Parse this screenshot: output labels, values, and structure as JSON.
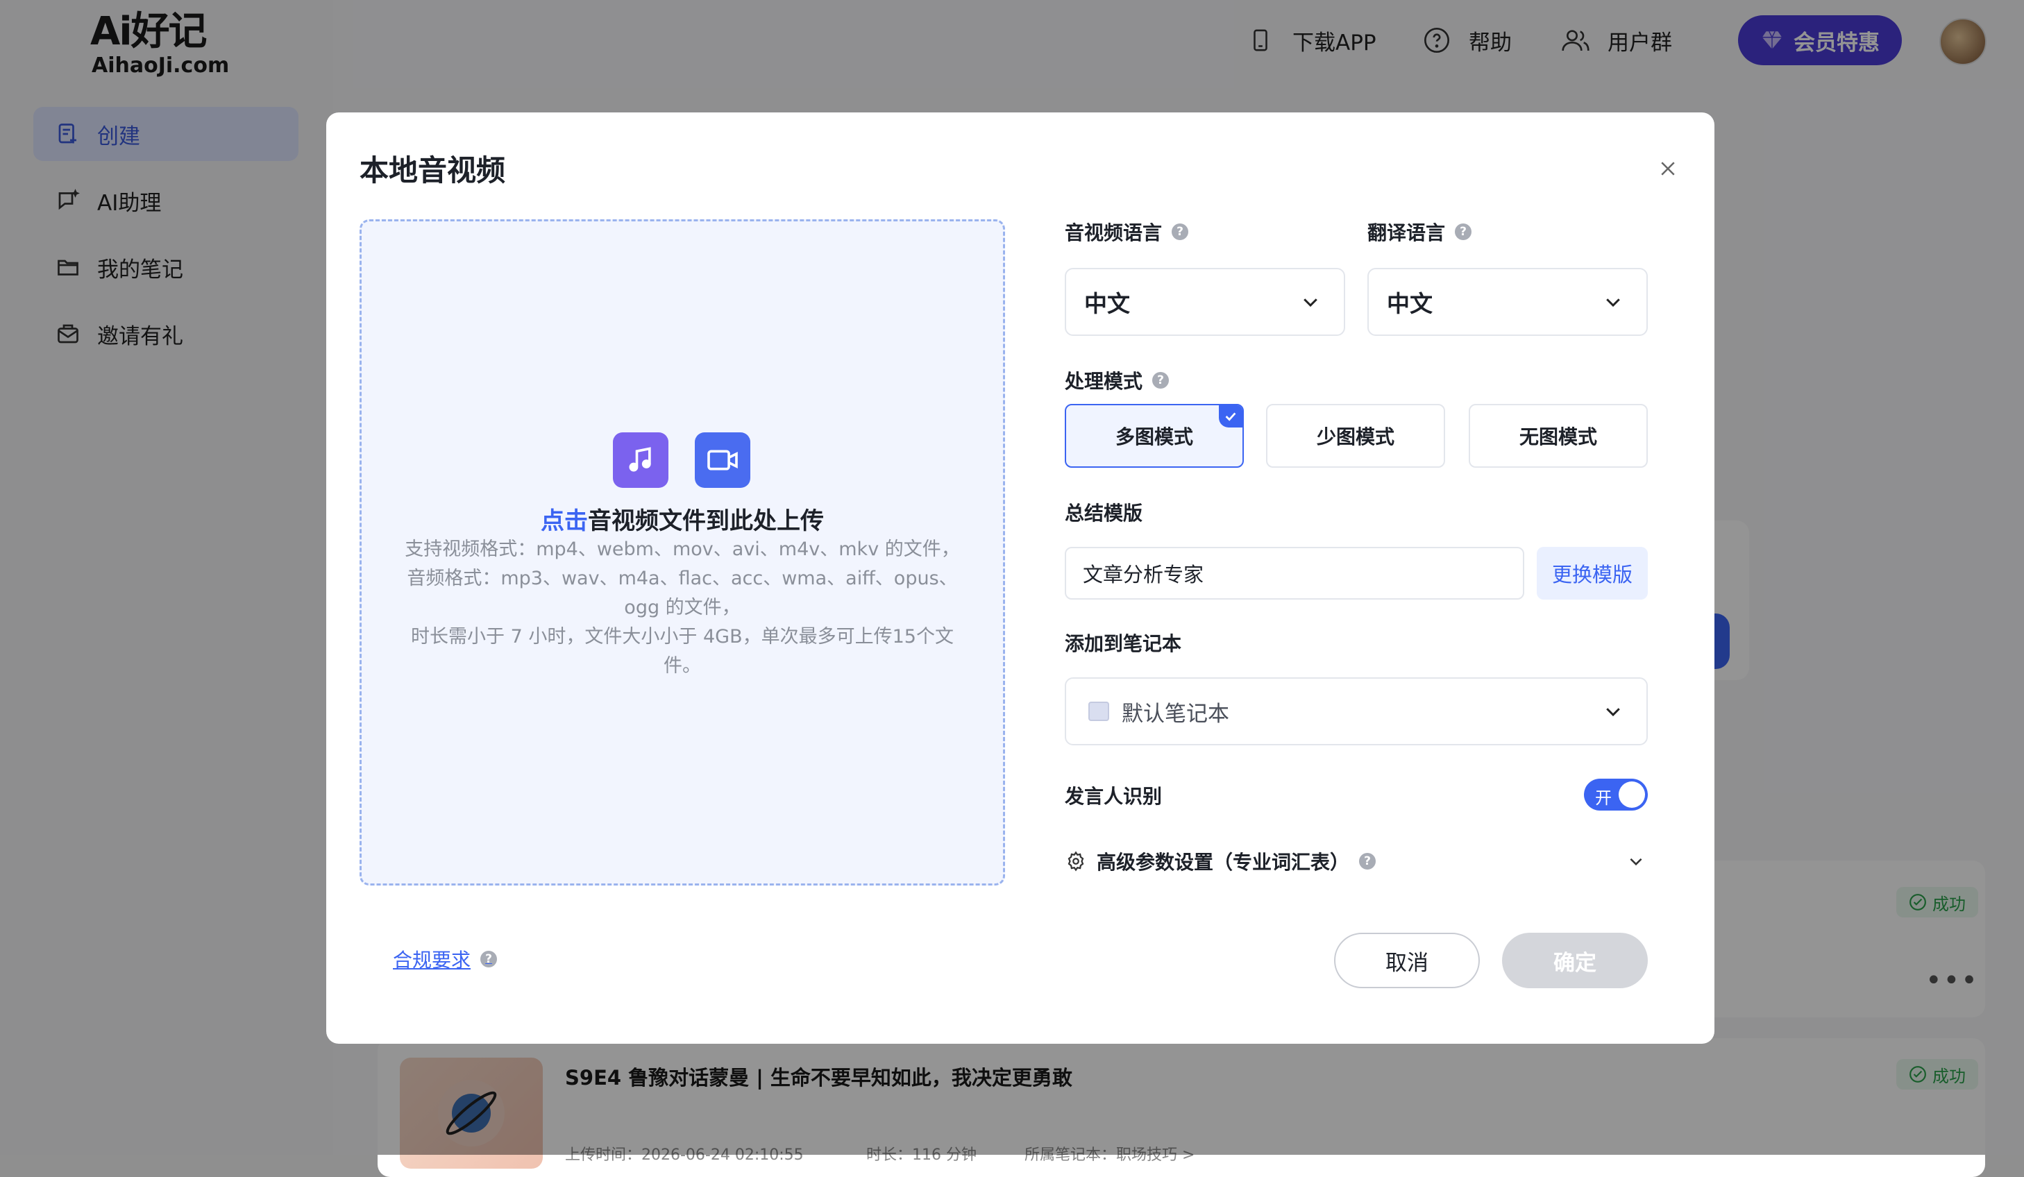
{
  "brand": {
    "logo_top": "Ai好记",
    "logo_bottom": "AihaoJi.com"
  },
  "sidebar": {
    "items": [
      {
        "label": "创建",
        "icon": "create-note-icon",
        "active": true
      },
      {
        "label": "AI助理",
        "icon": "ai-chat-icon",
        "active": false
      },
      {
        "label": "我的笔记",
        "icon": "folder-icon",
        "active": false
      },
      {
        "label": "邀请有礼",
        "icon": "gift-mail-icon",
        "active": false
      }
    ]
  },
  "topbar": {
    "download_app": "下载APP",
    "help": "帮助",
    "user_group": "用户群",
    "vip": "会员特惠"
  },
  "background_notes": [
    {
      "status": "成功"
    },
    {
      "title": "S9E4 鲁豫对话蒙曼 | 生命不要早知如此，我决定更勇敢",
      "status": "成功",
      "meta_upload": "上传时间：2026-06-24 02:10:55",
      "meta_duration": "时长：116 分钟",
      "meta_notebook": "所属笔记本：职场技巧 >"
    }
  ],
  "modal": {
    "title": "本地音视频",
    "upload": {
      "click_text": "点击",
      "title_rest": "音视频文件到此处上传",
      "desc_lines": [
        "支持视频格式：mp4、webm、mov、avi、m4v、mkv 的文件，",
        "音频格式：mp3、wav、m4a、flac、acc、wma、aiff、opus、",
        "ogg 的文件，",
        "时长需小于 7 小时，文件大小小于 4GB，单次最多可上传15个文",
        "件。"
      ]
    },
    "audio_language": {
      "label": "音视频语言",
      "value": "中文"
    },
    "translate_language": {
      "label": "翻译语言",
      "value": "中文"
    },
    "process_mode": {
      "label": "处理模式",
      "options": [
        "多图模式",
        "少图模式",
        "无图模式"
      ],
      "selected": "多图模式"
    },
    "summary_template": {
      "label": "总结模版",
      "value": "文章分析专家",
      "change_button": "更换模版"
    },
    "notebook": {
      "label": "添加到笔记本",
      "value": "默认笔记本"
    },
    "speaker_recognition": {
      "label": "发言人识别",
      "toggle_text": "开",
      "enabled": true
    },
    "advanced": {
      "label": "高级参数设置（专业词汇表）"
    },
    "compliance": "合规要求",
    "cancel": "取消",
    "confirm": "确定"
  },
  "colors": {
    "accent": "#3b64f2",
    "vip": "#4b3bd6",
    "success": "#2aa04a"
  }
}
